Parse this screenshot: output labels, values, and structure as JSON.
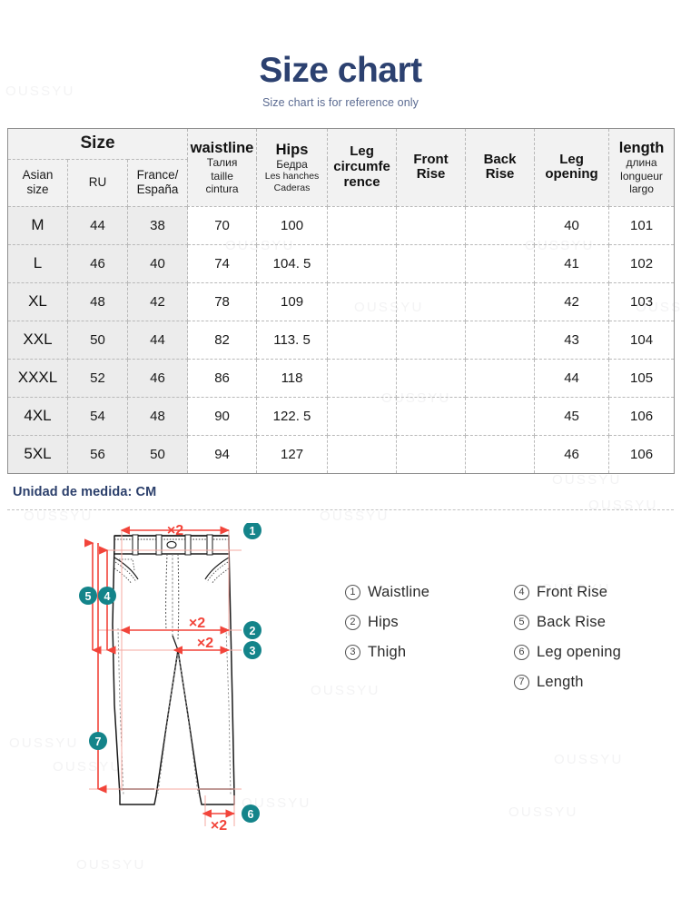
{
  "header": {
    "title": "Size chart",
    "subtitle": "Size chart is for reference only"
  },
  "watermark": {
    "text": "OUSSYU"
  },
  "table": {
    "group_header": "Size",
    "columns": [
      {
        "key": "asian_size",
        "main": "",
        "sub": "Asian size",
        "group": "Size"
      },
      {
        "key": "ru",
        "main": "",
        "sub": "RU",
        "group": "Size"
      },
      {
        "key": "france_espana",
        "main": "",
        "sub": "France/ España",
        "group": "Size"
      },
      {
        "key": "waistline",
        "main": "waistline",
        "sub": "Талия taille cintura",
        "group": ""
      },
      {
        "key": "hips",
        "main": "Hips",
        "sub": "Бедра Les hanches Caderas",
        "group": ""
      },
      {
        "key": "leg_circumference",
        "main": "Leg circumfe rence",
        "sub": "",
        "group": ""
      },
      {
        "key": "front_rise",
        "main": "Front Rise",
        "sub": "",
        "group": ""
      },
      {
        "key": "back_rise",
        "main": "Back Rise",
        "sub": "",
        "group": ""
      },
      {
        "key": "leg_opening",
        "main": "Leg opening",
        "sub": "",
        "group": ""
      },
      {
        "key": "length",
        "main": "length",
        "sub": "длина longueur largo",
        "group": ""
      }
    ],
    "headers": {
      "size": "Size",
      "asian_size_line1": "Asian",
      "asian_size_line2": "size",
      "ru": "RU",
      "france_line1": "France/",
      "france_line2": "España",
      "waistline_main": "waistline",
      "waistline_sub1": "Талия",
      "waistline_sub2": "taille",
      "waistline_sub3": "cintura",
      "hips_main": "Hips",
      "hips_sub1": "Бедра",
      "hips_sub2": "Les hanches",
      "hips_sub3": "Caderas",
      "leg_circ_line1": "Leg",
      "leg_circ_line2": "circumfe",
      "leg_circ_line3": "rence",
      "front_rise_line1": "Front",
      "front_rise_line2": "Rise",
      "back_rise_line1": "Back",
      "back_rise_line2": "Rise",
      "leg_opening_line1": "Leg",
      "leg_opening_line2": "opening",
      "length_main": "length",
      "length_sub1": "длина",
      "length_sub2": "longueur",
      "length_sub3": "largo"
    },
    "rows": [
      {
        "asian_size": "M",
        "ru": "44",
        "france_espana": "38",
        "waistline": "70",
        "hips": "100",
        "leg_circumference": "",
        "front_rise": "",
        "back_rise": "",
        "leg_opening": "40",
        "length": "101"
      },
      {
        "asian_size": "L",
        "ru": "46",
        "france_espana": "40",
        "waistline": "74",
        "hips": "104. 5",
        "leg_circumference": "",
        "front_rise": "",
        "back_rise": "",
        "leg_opening": "41",
        "length": "102"
      },
      {
        "asian_size": "XL",
        "ru": "48",
        "france_espana": "42",
        "waistline": "78",
        "hips": "109",
        "leg_circumference": "",
        "front_rise": "",
        "back_rise": "",
        "leg_opening": "42",
        "length": "103"
      },
      {
        "asian_size": "XXL",
        "ru": "50",
        "france_espana": "44",
        "waistline": "82",
        "hips": "113. 5",
        "leg_circumference": "",
        "front_rise": "",
        "back_rise": "",
        "leg_opening": "43",
        "length": "104"
      },
      {
        "asian_size": "XXXL",
        "ru": "52",
        "france_espana": "46",
        "waistline": "86",
        "hips": "118",
        "leg_circumference": "",
        "front_rise": "",
        "back_rise": "",
        "leg_opening": "44",
        "length": "105"
      },
      {
        "asian_size": "4XL",
        "ru": "54",
        "france_espana": "48",
        "waistline": "90",
        "hips": "122. 5",
        "leg_circumference": "",
        "front_rise": "",
        "back_rise": "",
        "leg_opening": "45",
        "length": "106"
      },
      {
        "asian_size": "5XL",
        "ru": "56",
        "france_espana": "50",
        "waistline": "94",
        "hips": "127",
        "leg_circumference": "",
        "front_rise": "",
        "back_rise": "",
        "leg_opening": "46",
        "length": "106"
      }
    ],
    "unit_note": "Unidad de medida: CM"
  },
  "diagram": {
    "multiplier_label": "×2",
    "markers": [
      {
        "num": "1",
        "label": "Waistline"
      },
      {
        "num": "2",
        "label": "Hips"
      },
      {
        "num": "3",
        "label": "Thigh"
      },
      {
        "num": "4",
        "label": "Front Rise"
      },
      {
        "num": "5",
        "label": "Back Rise"
      },
      {
        "num": "6",
        "label": "Leg opening"
      },
      {
        "num": "7",
        "label": "Length"
      }
    ],
    "legend_left": [
      {
        "num": "①",
        "label": "Waistline"
      },
      {
        "num": "②",
        "label": "Hips"
      },
      {
        "num": "③",
        "label": "Thigh"
      }
    ],
    "legend_right": [
      {
        "num": "④",
        "label": "Front Rise"
      },
      {
        "num": "⑤",
        "label": "Back Rise"
      },
      {
        "num": "⑥",
        "label": "Leg opening"
      },
      {
        "num": "⑦",
        "label": "Length"
      }
    ]
  },
  "colors": {
    "title": "#2c4170",
    "subtitle": "#5a6a91",
    "unit_note": "#2b3f6b",
    "badge_teal": "#14848a",
    "measure_red": "#f2443a",
    "header_bg": "#f2f2f2",
    "size_col_bg": "#ececec"
  }
}
